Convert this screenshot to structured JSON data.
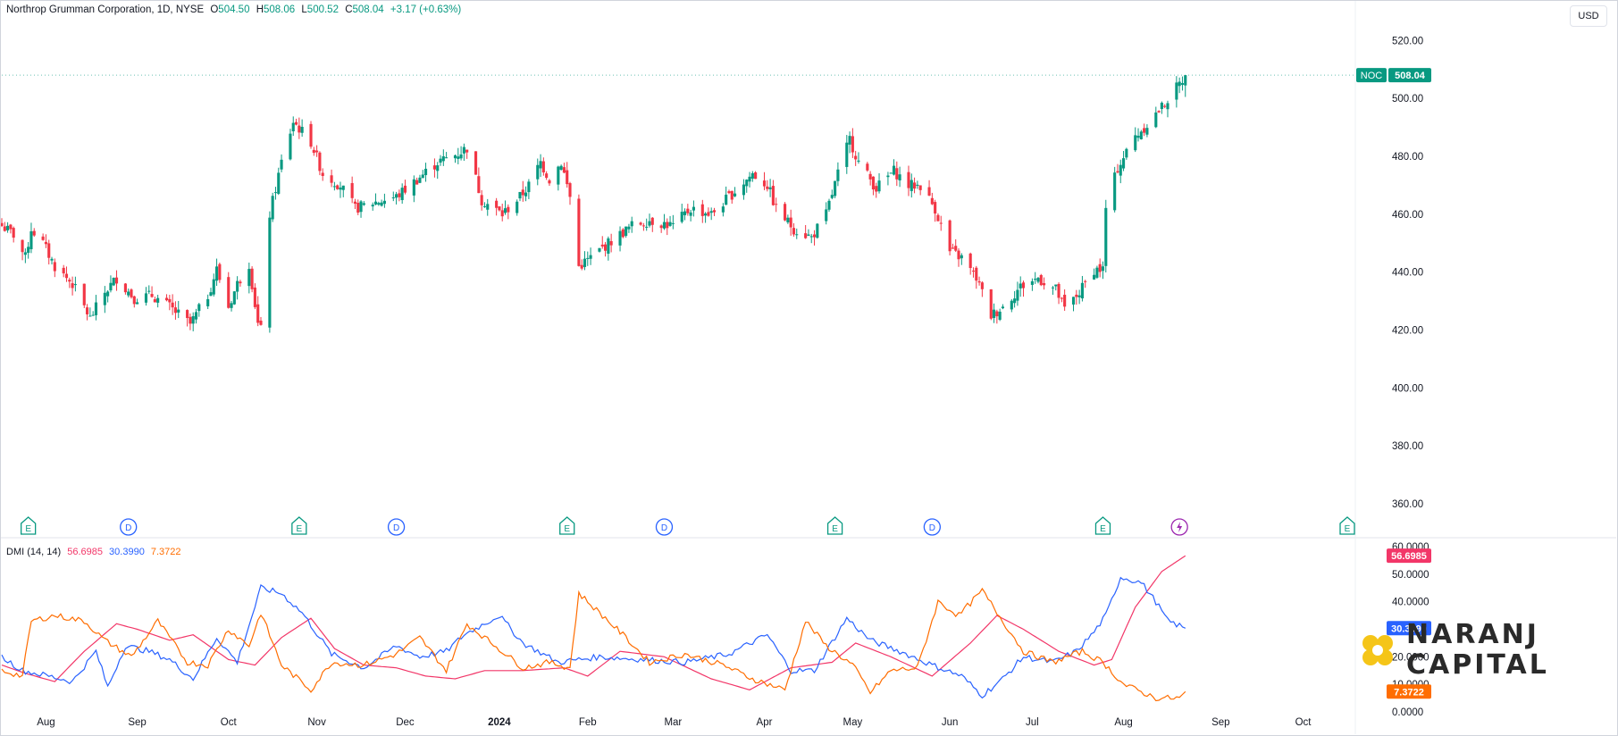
{
  "header": {
    "symbol_line": "Northrop Grumman Corporation, 1D, NYSE",
    "o_label": "O",
    "o_value": "504.50",
    "h_label": "H",
    "h_value": "508.06",
    "l_label": "L",
    "l_value": "500.52",
    "c_label": "C",
    "c_value": "508.04",
    "change": "+3.17 (+0.63%)"
  },
  "currency": "USD",
  "logo": {
    "line1": "NARANJ",
    "line2": "CAPITAL"
  },
  "colors": {
    "up": "#089981",
    "down": "#f23645",
    "adx": "#f23668",
    "plus_di": "#2962ff",
    "minus_di": "#ff6d00",
    "event": "#089981",
    "dividend": "#2962ff"
  },
  "chart_data": [
    {
      "type": "candlestick",
      "title": "Northrop Grumman Corporation, 1D, NYSE",
      "symbol": "NOC",
      "last_price": 508.04,
      "last_price_label": "508.04",
      "ylim": [
        352,
        534
      ],
      "y_ticks": [
        {
          "v": 520,
          "label": "520.00"
        },
        {
          "v": 500,
          "label": "500.00"
        },
        {
          "v": 480,
          "label": "480.00"
        },
        {
          "v": 460,
          "label": "460.00"
        },
        {
          "v": 440,
          "label": "440.00"
        },
        {
          "v": 420,
          "label": "420.00"
        },
        {
          "v": 400,
          "label": "400.00"
        },
        {
          "v": 380,
          "label": "380.00"
        },
        {
          "v": 360,
          "label": "360.00"
        }
      ],
      "x_ticks": [
        {
          "date": "2023-08-01",
          "label": "Aug"
        },
        {
          "date": "2023-09-01",
          "label": "Sep"
        },
        {
          "date": "2023-10-02",
          "label": "Oct"
        },
        {
          "date": "2023-11-01",
          "label": "Nov"
        },
        {
          "date": "2023-12-01",
          "label": "Dec"
        },
        {
          "date": "2024-01-02",
          "label": "2024"
        },
        {
          "date": "2024-02-01",
          "label": "Feb"
        },
        {
          "date": "2024-03-01",
          "label": "Mar"
        },
        {
          "date": "2024-04-01",
          "label": "Apr"
        },
        {
          "date": "2024-05-01",
          "label": "May"
        },
        {
          "date": "2024-06-03",
          "label": "Jun"
        },
        {
          "date": "2024-07-01",
          "label": "Jul"
        },
        {
          "date": "2024-08-01",
          "label": "Aug"
        },
        {
          "date": "2024-09-03",
          "label": "Sep"
        },
        {
          "date": "2024-10-01",
          "label": "Oct"
        }
      ],
      "x_range": [
        "2023-07-17",
        "2024-10-16"
      ],
      "events": [
        {
          "date": "2023-07-26",
          "type": "E"
        },
        {
          "date": "2023-08-29",
          "type": "D"
        },
        {
          "date": "2023-10-26",
          "type": "E"
        },
        {
          "date": "2023-11-28",
          "type": "D"
        },
        {
          "date": "2024-01-25",
          "type": "E"
        },
        {
          "date": "2024-02-27",
          "type": "D"
        },
        {
          "date": "2024-04-25",
          "type": "E"
        },
        {
          "date": "2024-05-28",
          "type": "D"
        },
        {
          "date": "2024-07-25",
          "type": "E"
        },
        {
          "date": "2024-08-20",
          "type": "S"
        },
        {
          "date": "2024-10-24",
          "type": "E"
        }
      ],
      "keypoints": [
        [
          "2023-07-17",
          456
        ],
        [
          "2023-07-21",
          453
        ],
        [
          "2023-07-25",
          445
        ],
        [
          "2023-07-27",
          455
        ],
        [
          "2023-07-31",
          450
        ],
        [
          "2023-08-04",
          442
        ],
        [
          "2023-08-10",
          436
        ],
        [
          "2023-08-16",
          424
        ],
        [
          "2023-08-21",
          433
        ],
        [
          "2023-08-25",
          438
        ],
        [
          "2023-08-31",
          431
        ],
        [
          "2023-09-06",
          432
        ],
        [
          "2023-09-12",
          428
        ],
        [
          "2023-09-19",
          422
        ],
        [
          "2023-09-25",
          432
        ],
        [
          "2023-09-28",
          441
        ],
        [
          "2023-10-02",
          428
        ],
        [
          "2023-10-05",
          436
        ],
        [
          "2023-10-09",
          443
        ],
        [
          "2023-10-12",
          422
        ],
        [
          "2023-10-13",
          420
        ],
        [
          "2023-10-16",
          460
        ],
        [
          "2023-10-20",
          478
        ],
        [
          "2023-10-24",
          492
        ],
        [
          "2023-10-30",
          485
        ],
        [
          "2023-11-03",
          474
        ],
        [
          "2023-11-09",
          470
        ],
        [
          "2023-11-14",
          462
        ],
        [
          "2023-11-20",
          464
        ],
        [
          "2023-11-28",
          466
        ],
        [
          "2023-12-05",
          472
        ],
        [
          "2023-12-12",
          478
        ],
        [
          "2023-12-19",
          481
        ],
        [
          "2023-12-22",
          483
        ],
        [
          "2023-12-27",
          465
        ],
        [
          "2024-01-03",
          460
        ],
        [
          "2024-01-09",
          466
        ],
        [
          "2024-01-12",
          470
        ],
        [
          "2024-01-16",
          478
        ],
        [
          "2024-01-19",
          472
        ],
        [
          "2024-01-23",
          478
        ],
        [
          "2024-01-26",
          466
        ],
        [
          "2024-01-29",
          442
        ],
        [
          "2024-02-02",
          445
        ],
        [
          "2024-02-08",
          450
        ],
        [
          "2024-02-16",
          456
        ],
        [
          "2024-02-22",
          458
        ],
        [
          "2024-03-01",
          456
        ],
        [
          "2024-03-07",
          462
        ],
        [
          "2024-03-14",
          460
        ],
        [
          "2024-03-21",
          467
        ],
        [
          "2024-03-28",
          474
        ],
        [
          "2024-04-02",
          470
        ],
        [
          "2024-04-05",
          462
        ],
        [
          "2024-04-11",
          455
        ],
        [
          "2024-04-17",
          452
        ],
        [
          "2024-04-22",
          460
        ],
        [
          "2024-04-26",
          474
        ],
        [
          "2024-04-30",
          486
        ],
        [
          "2024-05-03",
          478
        ],
        [
          "2024-05-09",
          469
        ],
        [
          "2024-05-15",
          475
        ],
        [
          "2024-05-20",
          470
        ],
        [
          "2024-05-24",
          470
        ],
        [
          "2024-05-29",
          462
        ],
        [
          "2024-06-03",
          447
        ],
        [
          "2024-06-07",
          445
        ],
        [
          "2024-06-12",
          438
        ],
        [
          "2024-06-17",
          425
        ],
        [
          "2024-06-21",
          428
        ],
        [
          "2024-06-27",
          435
        ],
        [
          "2024-07-03",
          438
        ],
        [
          "2024-07-09",
          434
        ],
        [
          "2024-07-12",
          427
        ],
        [
          "2024-07-17",
          433
        ],
        [
          "2024-07-22",
          441
        ],
        [
          "2024-07-25",
          441
        ],
        [
          "2024-07-26",
          462
        ],
        [
          "2024-07-30",
          476
        ],
        [
          "2024-08-05",
          487
        ],
        [
          "2024-08-09",
          491
        ],
        [
          "2024-08-14",
          497
        ],
        [
          "2024-08-20",
          505
        ],
        [
          "2024-08-22",
          508.04
        ]
      ]
    },
    {
      "type": "line",
      "title": "DMI",
      "params": "(14, 14)",
      "ylim": [
        0,
        60
      ],
      "y_ticks": [
        {
          "v": 60,
          "label": "60.0000"
        },
        {
          "v": 50,
          "label": "50.0000"
        },
        {
          "v": 40,
          "label": "40.0000"
        },
        {
          "v": 30,
          "label": "30.0000"
        },
        {
          "v": 20,
          "label": "20.0000"
        },
        {
          "v": 10,
          "label": "10.0000"
        },
        {
          "v": 0,
          "label": "0.0000"
        }
      ],
      "series": [
        {
          "color": "#f23668",
          "last": 56.6985,
          "last_label": "56.6985",
          "points": [
            [
              "2023-07-17",
              17
            ],
            [
              "2023-07-25",
              14
            ],
            [
              "2023-08-04",
              11
            ],
            [
              "2023-08-14",
              22
            ],
            [
              "2023-08-25",
              32
            ],
            [
              "2023-09-01",
              30
            ],
            [
              "2023-09-12",
              26
            ],
            [
              "2023-09-20",
              28
            ],
            [
              "2023-10-02",
              19
            ],
            [
              "2023-10-11",
              17
            ],
            [
              "2023-10-20",
              27
            ],
            [
              "2023-10-30",
              34
            ],
            [
              "2023-11-07",
              23
            ],
            [
              "2023-11-17",
              17
            ],
            [
              "2023-11-28",
              16
            ],
            [
              "2023-12-08",
              13
            ],
            [
              "2023-12-18",
              12
            ],
            [
              "2023-12-28",
              15
            ],
            [
              "2024-01-10",
              15
            ],
            [
              "2024-01-24",
              16
            ],
            [
              "2024-02-01",
              13
            ],
            [
              "2024-02-12",
              22
            ],
            [
              "2024-02-27",
              20
            ],
            [
              "2024-03-14",
              12
            ],
            [
              "2024-03-27",
              8
            ],
            [
              "2024-04-10",
              16
            ],
            [
              "2024-04-24",
              18
            ],
            [
              "2024-05-02",
              25
            ],
            [
              "2024-05-14",
              20
            ],
            [
              "2024-05-28",
              13
            ],
            [
              "2024-06-10",
              25
            ],
            [
              "2024-06-19",
              35
            ],
            [
              "2024-06-28",
              30
            ],
            [
              "2024-07-10",
              22
            ],
            [
              "2024-07-22",
              17
            ],
            [
              "2024-07-28",
              19
            ],
            [
              "2024-08-05",
              38
            ],
            [
              "2024-08-14",
              51
            ],
            [
              "2024-08-22",
              56.6985
            ]
          ]
        },
        {
          "color": "#2962ff",
          "last": 30.399,
          "last_label": "30.3990",
          "points": [
            [
              "2023-07-17",
              20
            ],
            [
              "2023-07-24",
              15
            ],
            [
              "2023-08-02",
              13
            ],
            [
              "2023-08-10",
              11
            ],
            [
              "2023-08-18",
              22
            ],
            [
              "2023-08-22",
              9
            ],
            [
              "2023-08-28",
              24
            ],
            [
              "2023-09-05",
              22
            ],
            [
              "2023-09-12",
              19
            ],
            [
              "2023-09-20",
              12
            ],
            [
              "2023-09-28",
              27
            ],
            [
              "2023-10-05",
              18
            ],
            [
              "2023-10-13",
              45
            ],
            [
              "2023-10-20",
              43
            ],
            [
              "2023-10-27",
              36
            ],
            [
              "2023-11-06",
              21
            ],
            [
              "2023-11-17",
              16
            ],
            [
              "2023-11-28",
              24
            ],
            [
              "2023-12-06",
              20
            ],
            [
              "2023-12-15",
              22
            ],
            [
              "2023-12-21",
              28
            ],
            [
              "2024-01-02",
              35
            ],
            [
              "2024-01-10",
              25
            ],
            [
              "2024-01-22",
              18
            ],
            [
              "2024-02-05",
              20
            ],
            [
              "2024-02-20",
              19
            ],
            [
              "2024-03-05",
              18
            ],
            [
              "2024-03-20",
              21
            ],
            [
              "2024-04-02",
              28
            ],
            [
              "2024-04-10",
              15
            ],
            [
              "2024-04-18",
              15
            ],
            [
              "2024-04-29",
              34
            ],
            [
              "2024-05-07",
              26
            ],
            [
              "2024-05-17",
              22
            ],
            [
              "2024-05-28",
              17
            ],
            [
              "2024-06-07",
              13
            ],
            [
              "2024-06-14",
              6
            ],
            [
              "2024-06-21",
              12
            ],
            [
              "2024-06-28",
              20
            ],
            [
              "2024-07-08",
              18
            ],
            [
              "2024-07-16",
              22
            ],
            [
              "2024-07-22",
              29
            ],
            [
              "2024-07-26",
              35
            ],
            [
              "2024-07-31",
              49
            ],
            [
              "2024-08-07",
              47
            ],
            [
              "2024-08-12",
              40
            ],
            [
              "2024-08-16",
              33
            ],
            [
              "2024-08-22",
              30.399
            ]
          ]
        },
        {
          "color": "#ff6d00",
          "last": 7.3722,
          "last_label": "7.3722",
          "points": [
            [
              "2023-07-17",
              15
            ],
            [
              "2023-07-24",
              13
            ],
            [
              "2023-07-27",
              33
            ],
            [
              "2023-08-04",
              35
            ],
            [
              "2023-08-14",
              33
            ],
            [
              "2023-08-21",
              26
            ],
            [
              "2023-08-30",
              20
            ],
            [
              "2023-09-08",
              33
            ],
            [
              "2023-09-18",
              18
            ],
            [
              "2023-09-25",
              17
            ],
            [
              "2023-10-02",
              30
            ],
            [
              "2023-10-09",
              24
            ],
            [
              "2023-10-13",
              36
            ],
            [
              "2023-10-20",
              17
            ],
            [
              "2023-10-30",
              8
            ],
            [
              "2023-11-06",
              18
            ],
            [
              "2023-11-17",
              17
            ],
            [
              "2023-11-28",
              21
            ],
            [
              "2023-12-06",
              27
            ],
            [
              "2023-12-15",
              15
            ],
            [
              "2023-12-22",
              32
            ],
            [
              "2024-01-03",
              22
            ],
            [
              "2024-01-10",
              16
            ],
            [
              "2024-01-19",
              18
            ],
            [
              "2024-01-26",
              16
            ],
            [
              "2024-01-29",
              43
            ],
            [
              "2024-02-05",
              36
            ],
            [
              "2024-02-13",
              28
            ],
            [
              "2024-02-22",
              18
            ],
            [
              "2024-03-05",
              21
            ],
            [
              "2024-03-18",
              17
            ],
            [
              "2024-03-28",
              12
            ],
            [
              "2024-04-08",
              8
            ],
            [
              "2024-04-15",
              33
            ],
            [
              "2024-04-22",
              24
            ],
            [
              "2024-05-01",
              17
            ],
            [
              "2024-05-07",
              7
            ],
            [
              "2024-05-14",
              15
            ],
            [
              "2024-05-23",
              16
            ],
            [
              "2024-05-30",
              40
            ],
            [
              "2024-06-06",
              35
            ],
            [
              "2024-06-14",
              44
            ],
            [
              "2024-06-21",
              33
            ],
            [
              "2024-06-28",
              22
            ],
            [
              "2024-07-08",
              18
            ],
            [
              "2024-07-18",
              22
            ],
            [
              "2024-07-25",
              18
            ],
            [
              "2024-08-01",
              10
            ],
            [
              "2024-08-12",
              5
            ],
            [
              "2024-08-20",
              5
            ],
            [
              "2024-08-22",
              7.3722
            ]
          ]
        }
      ]
    }
  ]
}
